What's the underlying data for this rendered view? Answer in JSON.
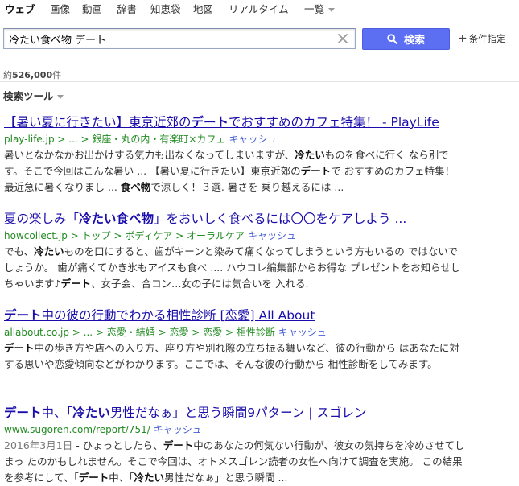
{
  "tabs": [
    {
      "label": "ウェブ",
      "active": true
    },
    {
      "label": "画像"
    },
    {
      "label": "動画"
    },
    {
      "label": "辞書"
    },
    {
      "label": "知恵袋"
    },
    {
      "label": "地図"
    },
    {
      "label": "リアルタイム"
    },
    {
      "label": "一覧"
    }
  ],
  "search": {
    "query": "冷たい食べ物 デート",
    "button_label": "検索",
    "conditions_label": "条件指定"
  },
  "result_count": {
    "prefix": "約",
    "count": "526,000",
    "suffix": "件"
  },
  "tools_label": "検索ツール",
  "cache_label": "キャッシュ",
  "results": [
    {
      "title_parts": [
        [
          "【暑い夏に行きたい】東京近郊の",
          false
        ],
        [
          "デート",
          true
        ],
        [
          "でおすすめのカフェ特集！ - PlayLife",
          false
        ]
      ],
      "url": "play-life.jp > ... > 銀座・丸の内・有楽町×カフェ",
      "snippet_parts": [
        [
          "暑いとなかなかお出かけする気力も出なくなってしまいますが、",
          false
        ],
        [
          "冷たい",
          true
        ],
        [
          "ものを食べに行く なら別です。そこで今回はこんな暑い ... 【暑い夏に行きたい】東京近郊の",
          false
        ],
        [
          "デート",
          true
        ],
        [
          "で おすすめのカフェ特集！ 最近急に暑くなりまし ... ",
          false
        ],
        [
          "食べ物",
          true
        ],
        [
          "で涼しく！３選. 暑さを 乗り越えるには ...",
          false
        ]
      ]
    },
    {
      "title_parts": [
        [
          "夏の楽しみ「",
          false
        ],
        [
          "冷たい食べ物",
          true
        ],
        [
          "」をおいしく食べるには〇〇をケアしよう ...",
          false
        ]
      ],
      "url": "howcollect.jp > トップ > ボディケア > オーラルケア",
      "snippet_parts": [
        [
          "でも、",
          false
        ],
        [
          "冷たい",
          true
        ],
        [
          "ものを口にすると、歯がキーンと染みて痛くなってしまうという方もいるの ではないでしょうか。 歯が痛くてかき氷もアイスも食べ .... ハウコレ編集部からお得な プレゼントをお知らせしちゃいます♪",
          false
        ],
        [
          "デート",
          true
        ],
        [
          "、女子会、合コン…女の子には気合いを 入れる.",
          false
        ]
      ]
    },
    {
      "title_parts": [
        [
          "デート",
          true
        ],
        [
          "中の彼の行動でわかる相性診断 [恋愛] All About",
          false
        ]
      ],
      "url": "allabout.co.jp > ... > 恋愛・結婚 > 恋愛 > 恋愛 > 相性診断",
      "snippet_parts": [
        [
          "デート",
          true
        ],
        [
          "中の歩き方や店への入り方、座り方や別れ際の立ち振る舞いなど、彼の行動から はあなたに対する思いや恋愛傾向などがわかります。ここでは、そんな彼の行動から 相性診断をしてみます。",
          false
        ]
      ]
    },
    {
      "title_parts": [
        [
          "デート",
          true
        ],
        [
          "中、「",
          false
        ],
        [
          "冷たい",
          true
        ],
        [
          "男性だなぁ」と思う瞬間9パターン | スゴレン",
          false
        ]
      ],
      "url": "www.sugoren.com/report/751/",
      "snippet_date": "2016年3月1日",
      "snippet_parts": [
        [
          " - ひょっとしたら、",
          false
        ],
        [
          "デート",
          true
        ],
        [
          "中のあなたの何気ない行動が、彼女の気持ちを冷めさせてしまっ たのかもしれません。そこで今回は、オトメスゴレン読者の女性へ向けて調査を実施。 この結果を参考にして、「",
          false
        ],
        [
          "デート",
          true
        ],
        [
          "中、「",
          false
        ],
        [
          "冷たい",
          true
        ],
        [
          "男性だなぁ」と思う瞬間 ...",
          false
        ]
      ]
    }
  ],
  "colors": {
    "link": "#1a0dab",
    "url": "#228b22",
    "cache": "#4a61d4",
    "button": "#5c6ef2"
  }
}
